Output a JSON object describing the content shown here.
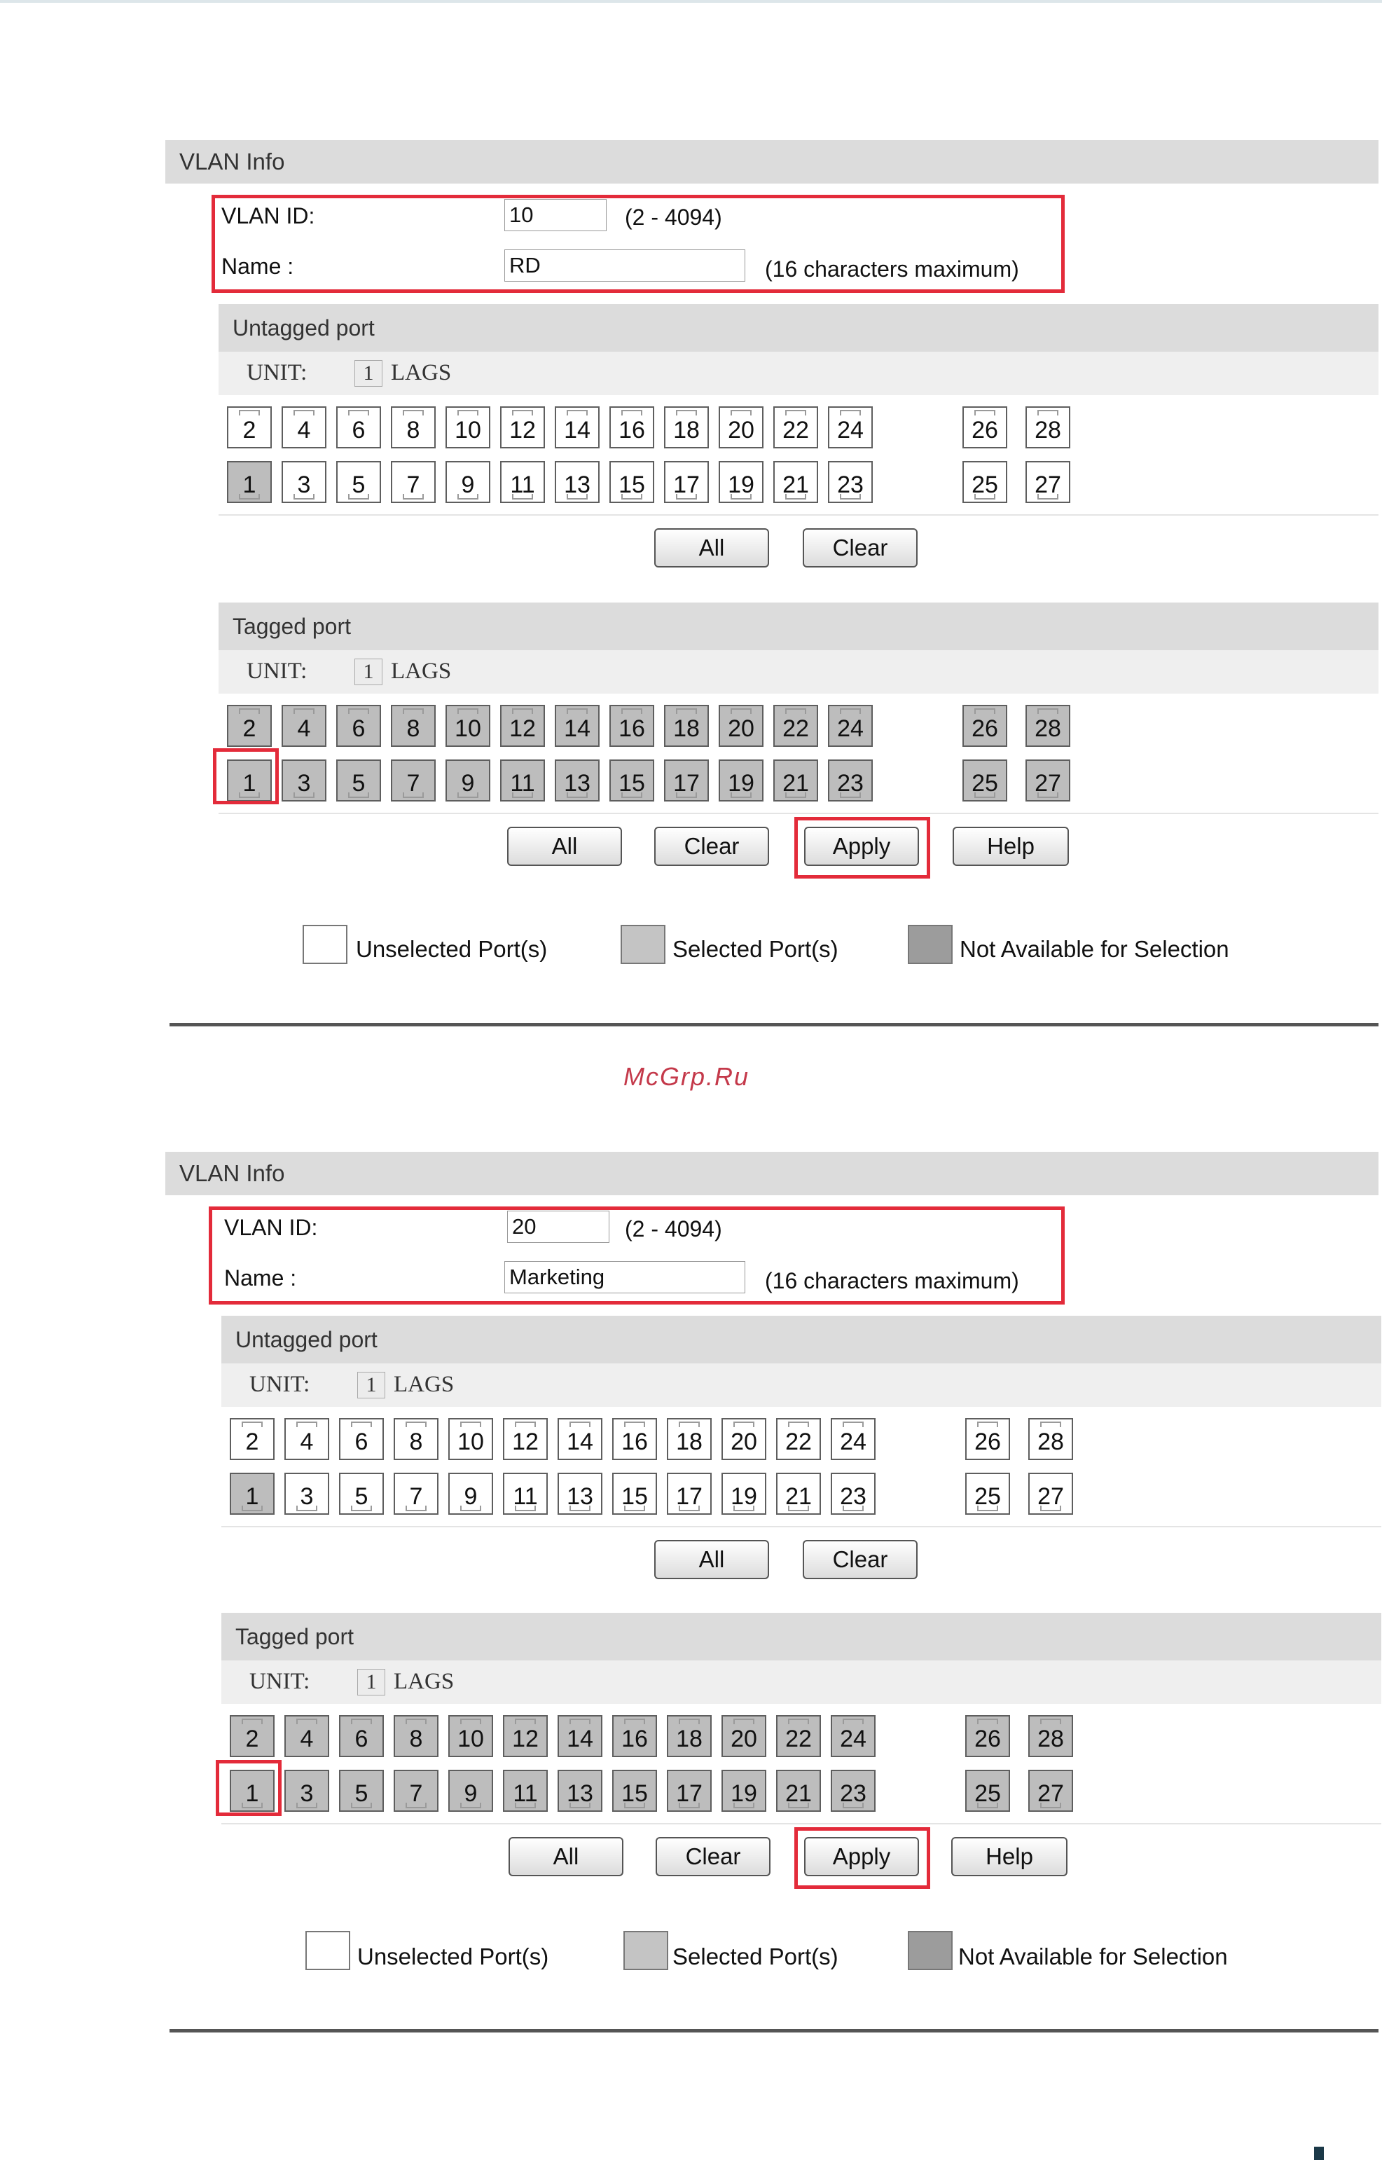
{
  "panels": [
    {
      "header": "VLAN Info",
      "vlan_id_label": "VLAN ID:",
      "vlan_id_value": "10",
      "vlan_id_hint": "(2 - 4094)",
      "name_label": "Name :",
      "name_value": "RD",
      "name_hint": "(16 characters maximum)",
      "untagged": {
        "title": "Untagged port",
        "unit_label": "UNIT:",
        "unit_value": "1",
        "lags_label": "LAGS",
        "top_ports": [
          "2",
          "4",
          "6",
          "8",
          "10",
          "12",
          "14",
          "16",
          "18",
          "20",
          "22",
          "24"
        ],
        "bottom_ports": [
          "1",
          "3",
          "5",
          "7",
          "9",
          "11",
          "13",
          "15",
          "17",
          "19",
          "21",
          "23"
        ],
        "top_extra": [
          "26",
          "28"
        ],
        "bottom_extra": [
          "25",
          "27"
        ],
        "selected_ports": [
          "1"
        ],
        "buttons": {
          "all": "All",
          "clear": "Clear"
        }
      },
      "tagged": {
        "title": "Tagged port",
        "unit_label": "UNIT:",
        "unit_value": "1",
        "lags_label": "LAGS",
        "top_ports": [
          "2",
          "4",
          "6",
          "8",
          "10",
          "12",
          "14",
          "16",
          "18",
          "20",
          "22",
          "24"
        ],
        "bottom_ports": [
          "1",
          "3",
          "5",
          "7",
          "9",
          "11",
          "13",
          "15",
          "17",
          "19",
          "21",
          "23"
        ],
        "top_extra": [
          "26",
          "28"
        ],
        "bottom_extra": [
          "25",
          "27"
        ],
        "selected_ports": [
          "1"
        ],
        "buttons": {
          "all": "All",
          "clear": "Clear",
          "apply": "Apply",
          "help": "Help"
        }
      },
      "legend": {
        "unselected": "Unselected Port(s)",
        "selected": "Selected Port(s)",
        "not_available": "Not Available for Selection"
      }
    },
    {
      "header": "VLAN Info",
      "vlan_id_label": "VLAN ID:",
      "vlan_id_value": "20",
      "vlan_id_hint": "(2 - 4094)",
      "name_label": "Name :",
      "name_value": "Marketing",
      "name_hint": "(16 characters maximum)",
      "untagged": {
        "title": "Untagged port",
        "unit_label": "UNIT:",
        "unit_value": "1",
        "lags_label": "LAGS",
        "top_ports": [
          "2",
          "4",
          "6",
          "8",
          "10",
          "12",
          "14",
          "16",
          "18",
          "20",
          "22",
          "24"
        ],
        "bottom_ports": [
          "1",
          "3",
          "5",
          "7",
          "9",
          "11",
          "13",
          "15",
          "17",
          "19",
          "21",
          "23"
        ],
        "top_extra": [
          "26",
          "28"
        ],
        "bottom_extra": [
          "25",
          "27"
        ],
        "selected_ports": [
          "1"
        ],
        "buttons": {
          "all": "All",
          "clear": "Clear"
        }
      },
      "tagged": {
        "title": "Tagged port",
        "unit_label": "UNIT:",
        "unit_value": "1",
        "lags_label": "LAGS",
        "top_ports": [
          "2",
          "4",
          "6",
          "8",
          "10",
          "12",
          "14",
          "16",
          "18",
          "20",
          "22",
          "24"
        ],
        "bottom_ports": [
          "1",
          "3",
          "5",
          "7",
          "9",
          "11",
          "13",
          "15",
          "17",
          "19",
          "21",
          "23"
        ],
        "top_extra": [
          "26",
          "28"
        ],
        "bottom_extra": [
          "25",
          "27"
        ],
        "selected_ports": [
          "1"
        ],
        "buttons": {
          "all": "All",
          "clear": "Clear",
          "apply": "Apply",
          "help": "Help"
        }
      },
      "legend": {
        "unselected": "Unselected Port(s)",
        "selected": "Selected Port(s)",
        "not_available": "Not Available for Selection"
      }
    }
  ],
  "watermark": "McGrp.Ru",
  "colors": {
    "highlight": "#e32b3a",
    "header_bg": "#dcdcdc",
    "selected_port": "#bdbdbd"
  }
}
